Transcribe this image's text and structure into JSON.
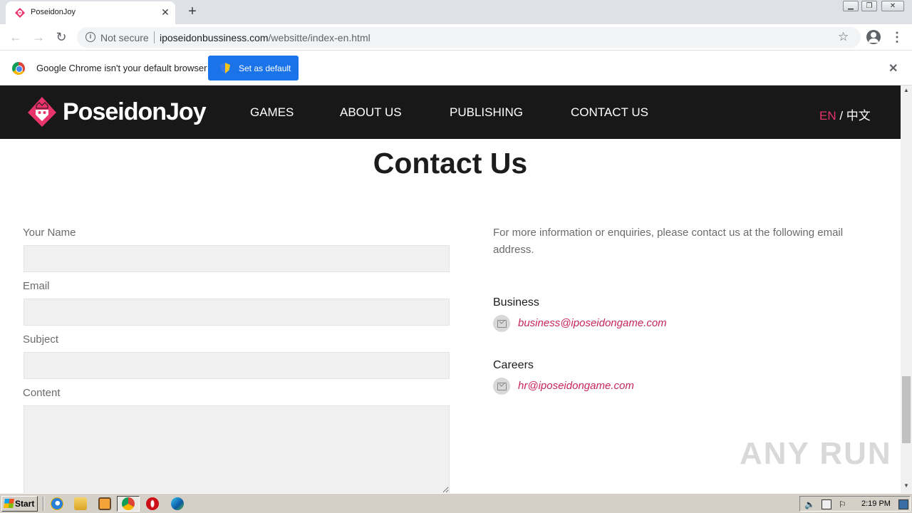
{
  "browser": {
    "tab_title": "PoseidonJoy",
    "tab_close": "✕",
    "new_tab": "+",
    "security_label": "Not secure",
    "url_host": "iposeidonbussiness.com",
    "url_path": "/websitte/index-en.html",
    "infobar_message": "Google Chrome isn't your default browser",
    "set_default_label": "Set as default",
    "infobar_close": "✕"
  },
  "site": {
    "brand": "PoseidonJoy",
    "nav": [
      {
        "label": "GAMES"
      },
      {
        "label": "ABOUT US"
      },
      {
        "label": "PUBLISHING"
      },
      {
        "label": "CONTACT US"
      }
    ],
    "lang_active": "EN",
    "lang_sep": " / ",
    "lang_other": "中文"
  },
  "page": {
    "title": "Contact Us",
    "form": {
      "name_label": "Your Name",
      "name_value": "",
      "email_label": "Email",
      "email_value": "",
      "subject_label": "Subject",
      "subject_value": "",
      "content_label": "Content",
      "content_value": ""
    },
    "info_text": "For more information or enquiries, please contact us at the following email address.",
    "contacts": [
      {
        "heading": "Business",
        "email": "business@iposeidongame.com"
      },
      {
        "heading": "Careers",
        "email": "hr@iposeidongame.com"
      }
    ]
  },
  "watermark": "ANY RUN",
  "taskbar": {
    "start_label": "Start",
    "clock": "2:19 PM"
  },
  "colors": {
    "accent": "#e8336b",
    "link": "#c8245c",
    "header_bg": "#181818",
    "chrome_button": "#1a73e8"
  }
}
